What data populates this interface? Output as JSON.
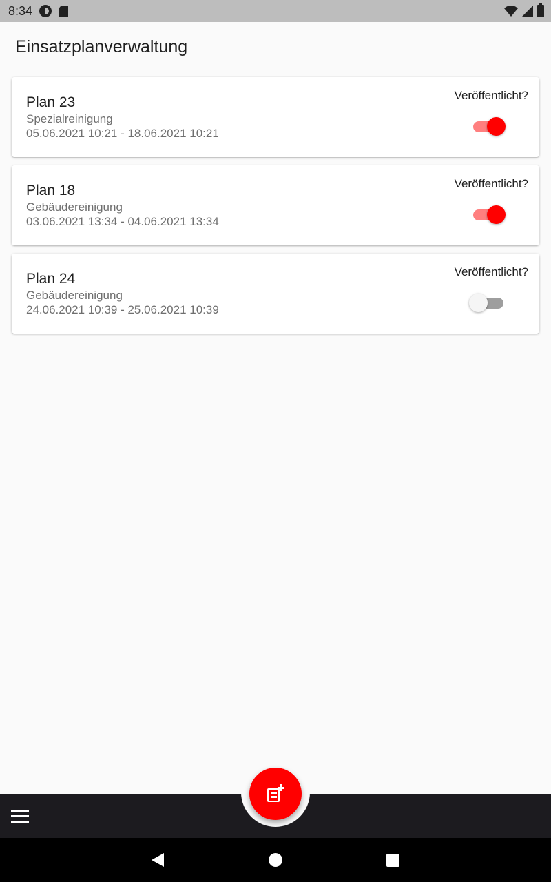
{
  "status_bar": {
    "time": "8:34",
    "icons_left": [
      "sync-status-icon",
      "sd-card-icon"
    ],
    "icons_right": [
      "wifi-icon",
      "signal-icon",
      "battery-icon"
    ]
  },
  "header": {
    "title": "Einsatzplanverwaltung"
  },
  "plans": [
    {
      "title": "Plan 23",
      "type": "Spezialreinigung",
      "range": "05.06.2021 10:21 - 18.06.2021 10:21",
      "publish_label": "Veröffentlicht?",
      "published": true
    },
    {
      "title": "Plan 18",
      "type": "Gebäudereinigung",
      "range": "03.06.2021 13:34 - 04.06.2021 13:34",
      "publish_label": "Veröffentlicht?",
      "published": true
    },
    {
      "title": "Plan 24",
      "type": "Gebäudereinigung",
      "range": "24.06.2021 10:39 - 25.06.2021 10:39",
      "publish_label": "Veröffentlicht?",
      "published": false
    }
  ],
  "bottom_bar": {
    "menu_icon": "hamburger-menu-icon",
    "fab_icon": "add-plan-icon"
  },
  "colors": {
    "accent": "#ff0000",
    "accent_track": "#ff7f7f",
    "bottom_bar": "#1c1b1f",
    "background": "#fafafa"
  }
}
